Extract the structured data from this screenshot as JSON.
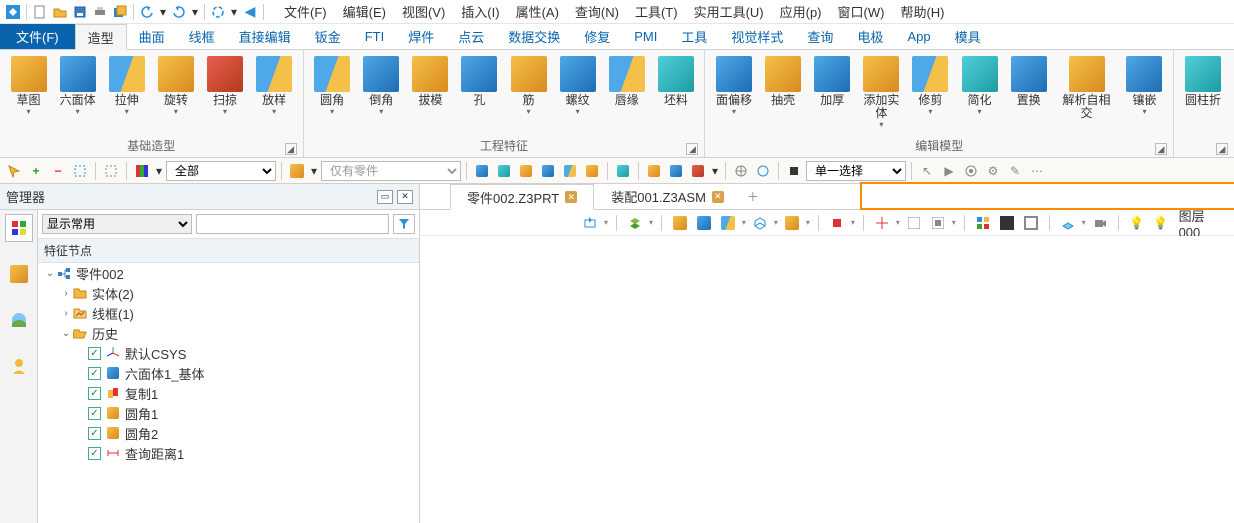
{
  "qat_menu": [
    "文件(F)",
    "编辑(E)",
    "视图(V)",
    "插入(I)",
    "属性(A)",
    "查询(N)",
    "工具(T)",
    "实用工具(U)",
    "应用(p)",
    "窗口(W)",
    "帮助(H)"
  ],
  "file_tab": "文件(F)",
  "ribbon_tabs": [
    "造型",
    "曲面",
    "线框",
    "直接编辑",
    "钣金",
    "FTI",
    "焊件",
    "点云",
    "数据交换",
    "修复",
    "PMI",
    "工具",
    "视觉样式",
    "查询",
    "电极",
    "App",
    "模具"
  ],
  "active_ribbon_tab": 0,
  "ribbon_groups": {
    "basic": {
      "label": "基础造型",
      "buttons": [
        {
          "label": "草图",
          "icon": "sketch"
        },
        {
          "label": "六面体",
          "icon": "cube"
        },
        {
          "label": "拉伸",
          "icon": "extrude"
        },
        {
          "label": "旋转",
          "icon": "revolve"
        },
        {
          "label": "扫掠",
          "icon": "sweep"
        },
        {
          "label": "放样",
          "icon": "loft"
        }
      ]
    },
    "eng": {
      "label": "工程特征",
      "buttons": [
        {
          "label": "圆角",
          "icon": "fillet"
        },
        {
          "label": "倒角",
          "icon": "chamfer"
        },
        {
          "label": "拔模",
          "icon": "draft"
        },
        {
          "label": "孔",
          "icon": "hole"
        },
        {
          "label": "筋",
          "icon": "rib"
        },
        {
          "label": "螺纹",
          "icon": "thread"
        },
        {
          "label": "唇缘",
          "icon": "lip"
        },
        {
          "label": "坯料",
          "icon": "stock"
        }
      ]
    },
    "edit": {
      "label": "编辑模型",
      "buttons": [
        {
          "label": "面偏移",
          "icon": "offset"
        },
        {
          "label": "抽壳",
          "icon": "shell"
        },
        {
          "label": "加厚",
          "icon": "thicken"
        },
        {
          "label": "添加实体",
          "icon": "addbody"
        },
        {
          "label": "修剪",
          "icon": "trim"
        },
        {
          "label": "简化",
          "icon": "simplify"
        },
        {
          "label": "置换",
          "icon": "replace"
        },
        {
          "label": "解析自相交",
          "icon": "selfx"
        },
        {
          "label": "镶嵌",
          "icon": "inlay"
        }
      ]
    },
    "extra": {
      "label": "",
      "buttons": [
        {
          "label": "圆柱折",
          "icon": "cylfold"
        }
      ]
    }
  },
  "toolbar2": {
    "combo1": "全部",
    "combo1_options": [
      "全部"
    ],
    "combo2": "仅有零件",
    "combo2_options": [
      "仅有零件"
    ],
    "combo3": "单一选择",
    "combo3_options": [
      "单一选择"
    ]
  },
  "manager": {
    "title": "管理器",
    "filter_selected": "显示常用",
    "filter_options": [
      "显示常用"
    ],
    "search_placeholder": "",
    "column_header": "特征节点",
    "tree": {
      "root": "零件002",
      "children": [
        {
          "label": "实体(2)",
          "icon": "folder-gold",
          "expandable": true
        },
        {
          "label": "线框(1)",
          "icon": "folder-wire",
          "expandable": true
        },
        {
          "label": "历史",
          "icon": "folder-open",
          "expanded": true,
          "children": [
            {
              "label": "默认CSYS",
              "icon": "csys",
              "checked": true
            },
            {
              "label": "六面体1_基体",
              "icon": "cube",
              "checked": true
            },
            {
              "label": "复制1",
              "icon": "copy",
              "checked": true
            },
            {
              "label": "圆角1",
              "icon": "fillet",
              "checked": true
            },
            {
              "label": "圆角2",
              "icon": "fillet",
              "checked": true
            },
            {
              "label": "查询距离1",
              "icon": "measure",
              "checked": true
            }
          ]
        }
      ]
    }
  },
  "doc_tabs": [
    {
      "label": "零件002.Z3PRT",
      "active": true
    },
    {
      "label": "装配001.Z3ASM",
      "active": false
    }
  ],
  "layer_label": "图层000"
}
